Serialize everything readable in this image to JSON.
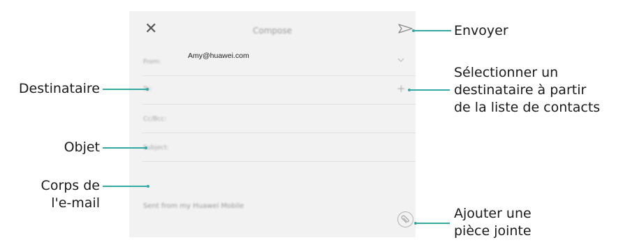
{
  "compose": {
    "title": "Compose",
    "from_label": "From:",
    "from_value": "Amy@huawei.com",
    "to_label": "To:",
    "cc_label": "Cc/Bcc:",
    "subject_label": "Subject:",
    "signature": "Sent from my Huawei Mobile",
    "close_symbol": "✕",
    "add_symbol": "+"
  },
  "callouts": {
    "send": "Envoyer",
    "recipient": "Destinataire",
    "contacts": [
      "Sélectionner un",
      "destinataire à partir",
      "de la liste de contacts"
    ],
    "subject": "Objet",
    "body": [
      "Corps de",
      "l'e-mail"
    ],
    "attach": [
      "Ajouter une",
      "pièce jointe"
    ]
  },
  "colors": {
    "accent": "#34a8a4",
    "background": "#f2f2f2"
  },
  "icons": [
    "close-icon",
    "send-icon",
    "chevron-down-icon",
    "plus-icon",
    "paperclip-icon"
  ]
}
